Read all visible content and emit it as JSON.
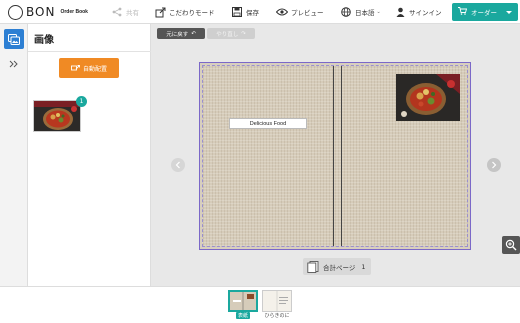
{
  "header": {
    "logo_text": "BON",
    "logo_sub": "Order Book",
    "items": {
      "share": "共有",
      "mode": "こだわりモード",
      "save": "保存",
      "preview": "プレビュー",
      "language": "日本語",
      "signin": "サインイン"
    },
    "order_button": "オーダー"
  },
  "panel": {
    "title": "画像",
    "auto_button": "自動配置",
    "thumb_badge": "1"
  },
  "canvas": {
    "undo_label": "元に戻す",
    "redo_label": "やり直し",
    "text_box": "Delicious Food",
    "page_count_label": "合計ページ",
    "page_count_value": "1"
  },
  "bottom": {
    "cover_label": "表紙",
    "page_label": "ひらきのに"
  },
  "colors": {
    "accent": "#1aa89e",
    "auto_button": "#f08a24",
    "rail_active": "#2d7fd3",
    "book_border": "#7b68c8"
  }
}
